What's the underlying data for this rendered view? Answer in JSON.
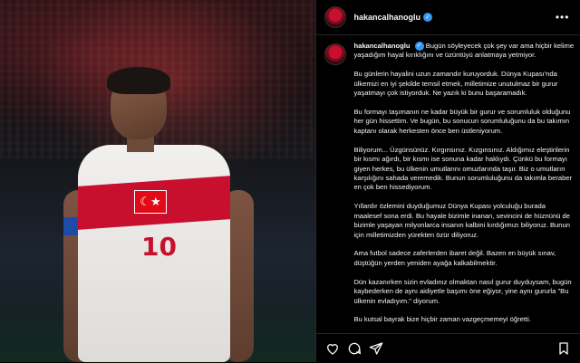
{
  "post": {
    "username": "hakancalhanoglu",
    "verified_mark": "✓",
    "more_label": "•••"
  },
  "media": {
    "jersey_number": "10",
    "flag_symbol": "☾★"
  },
  "caption": {
    "paragraphs": [
      "Bugün söyleyecek çok şey var ama hiçbir kelime yaşadığım hayal kırıklığını ve üzüntüyü anlatmaya yetmiyor.",
      "Bu günlerin hayalini uzun zamandır kuruyorduk. Dünya Kupası'nda ülkemizi en iyi şekilde temsil etmek, milletimize unutulmaz bir gurur yaşatmayı çok istiyorduk. Ne yazık ki bunu başaramadık.",
      "Bu formayı taşımanın ne kadar büyük bir gurur ve sorumluluk olduğunu her gün hissettim. Ve bugün, bu sonucun sorumluluğunu da bu takımın kaptanı olarak herkesten önce ben üstleniyorum.",
      "Biliyorum... Üzgünsünüz. Kırgınsınız. Kızgınsınız. Aldığımız eleştirilerin bir kısmı ağırdı, bir kısmı ise sonuna kadar haklıydı. Çünkü bu formayı giyen herkes, bu ülkenin umutlarını omuzlarında taşır. Biz o umutların karşılığını sahada veremedik. Bunun sorumluluğunu da takımla beraber en çok ben hissediyorum.",
      "Yıllardır özlemini duyduğumuz Dünya Kupası yolculuğu burada maalesef sona erdi. Bu hayale bizimle inanan, sevincini de hüznünü de bizimle yaşayan milyonlarca insanın kalbini kırdığımızı biliyoruz. Bunun için milletimizden yürekten özür diliyoruz.",
      "Ama futbol sadece zaferlerden ibaret değil. Bazen en büyük sınav, düştüğün yerden yeniden ayağa kalkabilmektir.",
      "Dün kazanırken sizin evladınız olmaktan nasıl gurur duyduysam, bugün kaybederken de aynı aidiyetle başımı öne eğiyor, yine aynı gururla \"Bu ülkenin evladıyım.\" diyorum.",
      "Bu kutsal bayrak bize hiçbir zaman vazgeçmemeyi öğretti."
    ]
  },
  "actions": {
    "like_icon": "heart-icon",
    "comment_icon": "comment-icon",
    "share_icon": "share-icon",
    "save_icon": "bookmark-icon"
  },
  "colors": {
    "verified": "#3797f0",
    "jersey_red": "#c8102e",
    "background": "#000000"
  }
}
